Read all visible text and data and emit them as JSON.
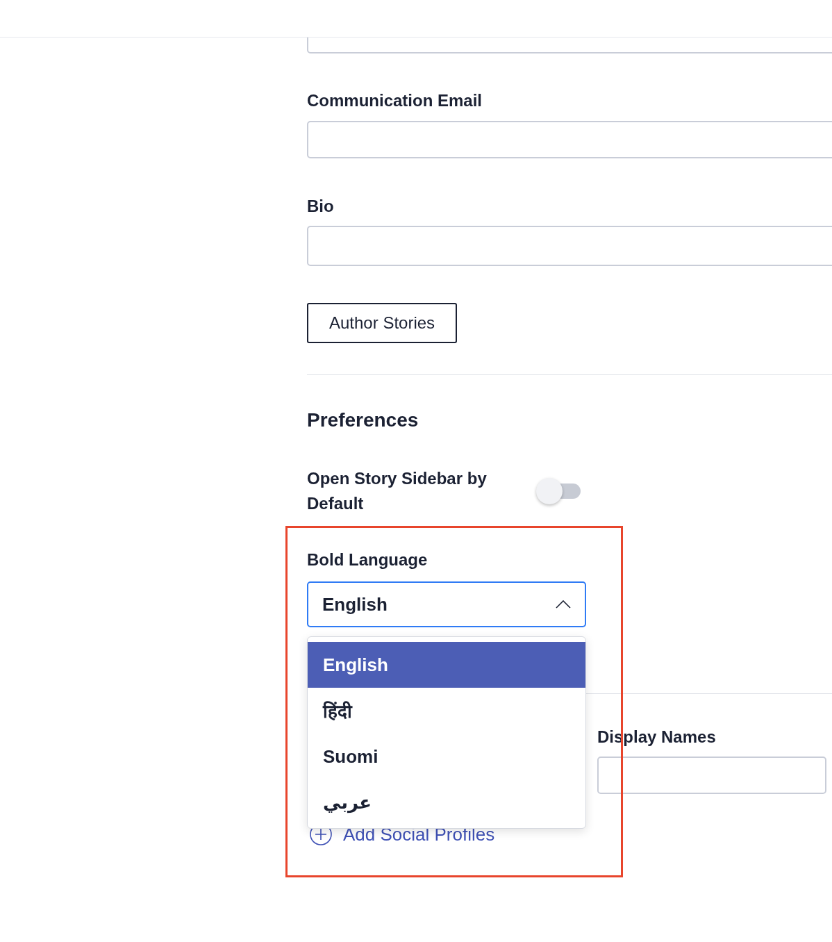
{
  "fields": [
    {
      "label": "Communication Email"
    },
    {
      "label": "Bio"
    }
  ],
  "author_stories_button": "Author Stories",
  "preferences": {
    "heading": "Preferences",
    "toggle": {
      "label": "Open Story Sidebar by Default",
      "on": false
    },
    "language": {
      "label": "Bold Language",
      "value": "English",
      "expanded": true,
      "options": [
        {
          "label": "English",
          "selected": true
        },
        {
          "label": "हिंदी",
          "selected": false
        },
        {
          "label": "Suomi",
          "selected": false
        },
        {
          "label": "عربي",
          "selected": false
        }
      ]
    }
  },
  "display_names": {
    "label": "Display Names"
  },
  "add_social_profiles": "Add Social Profiles"
}
